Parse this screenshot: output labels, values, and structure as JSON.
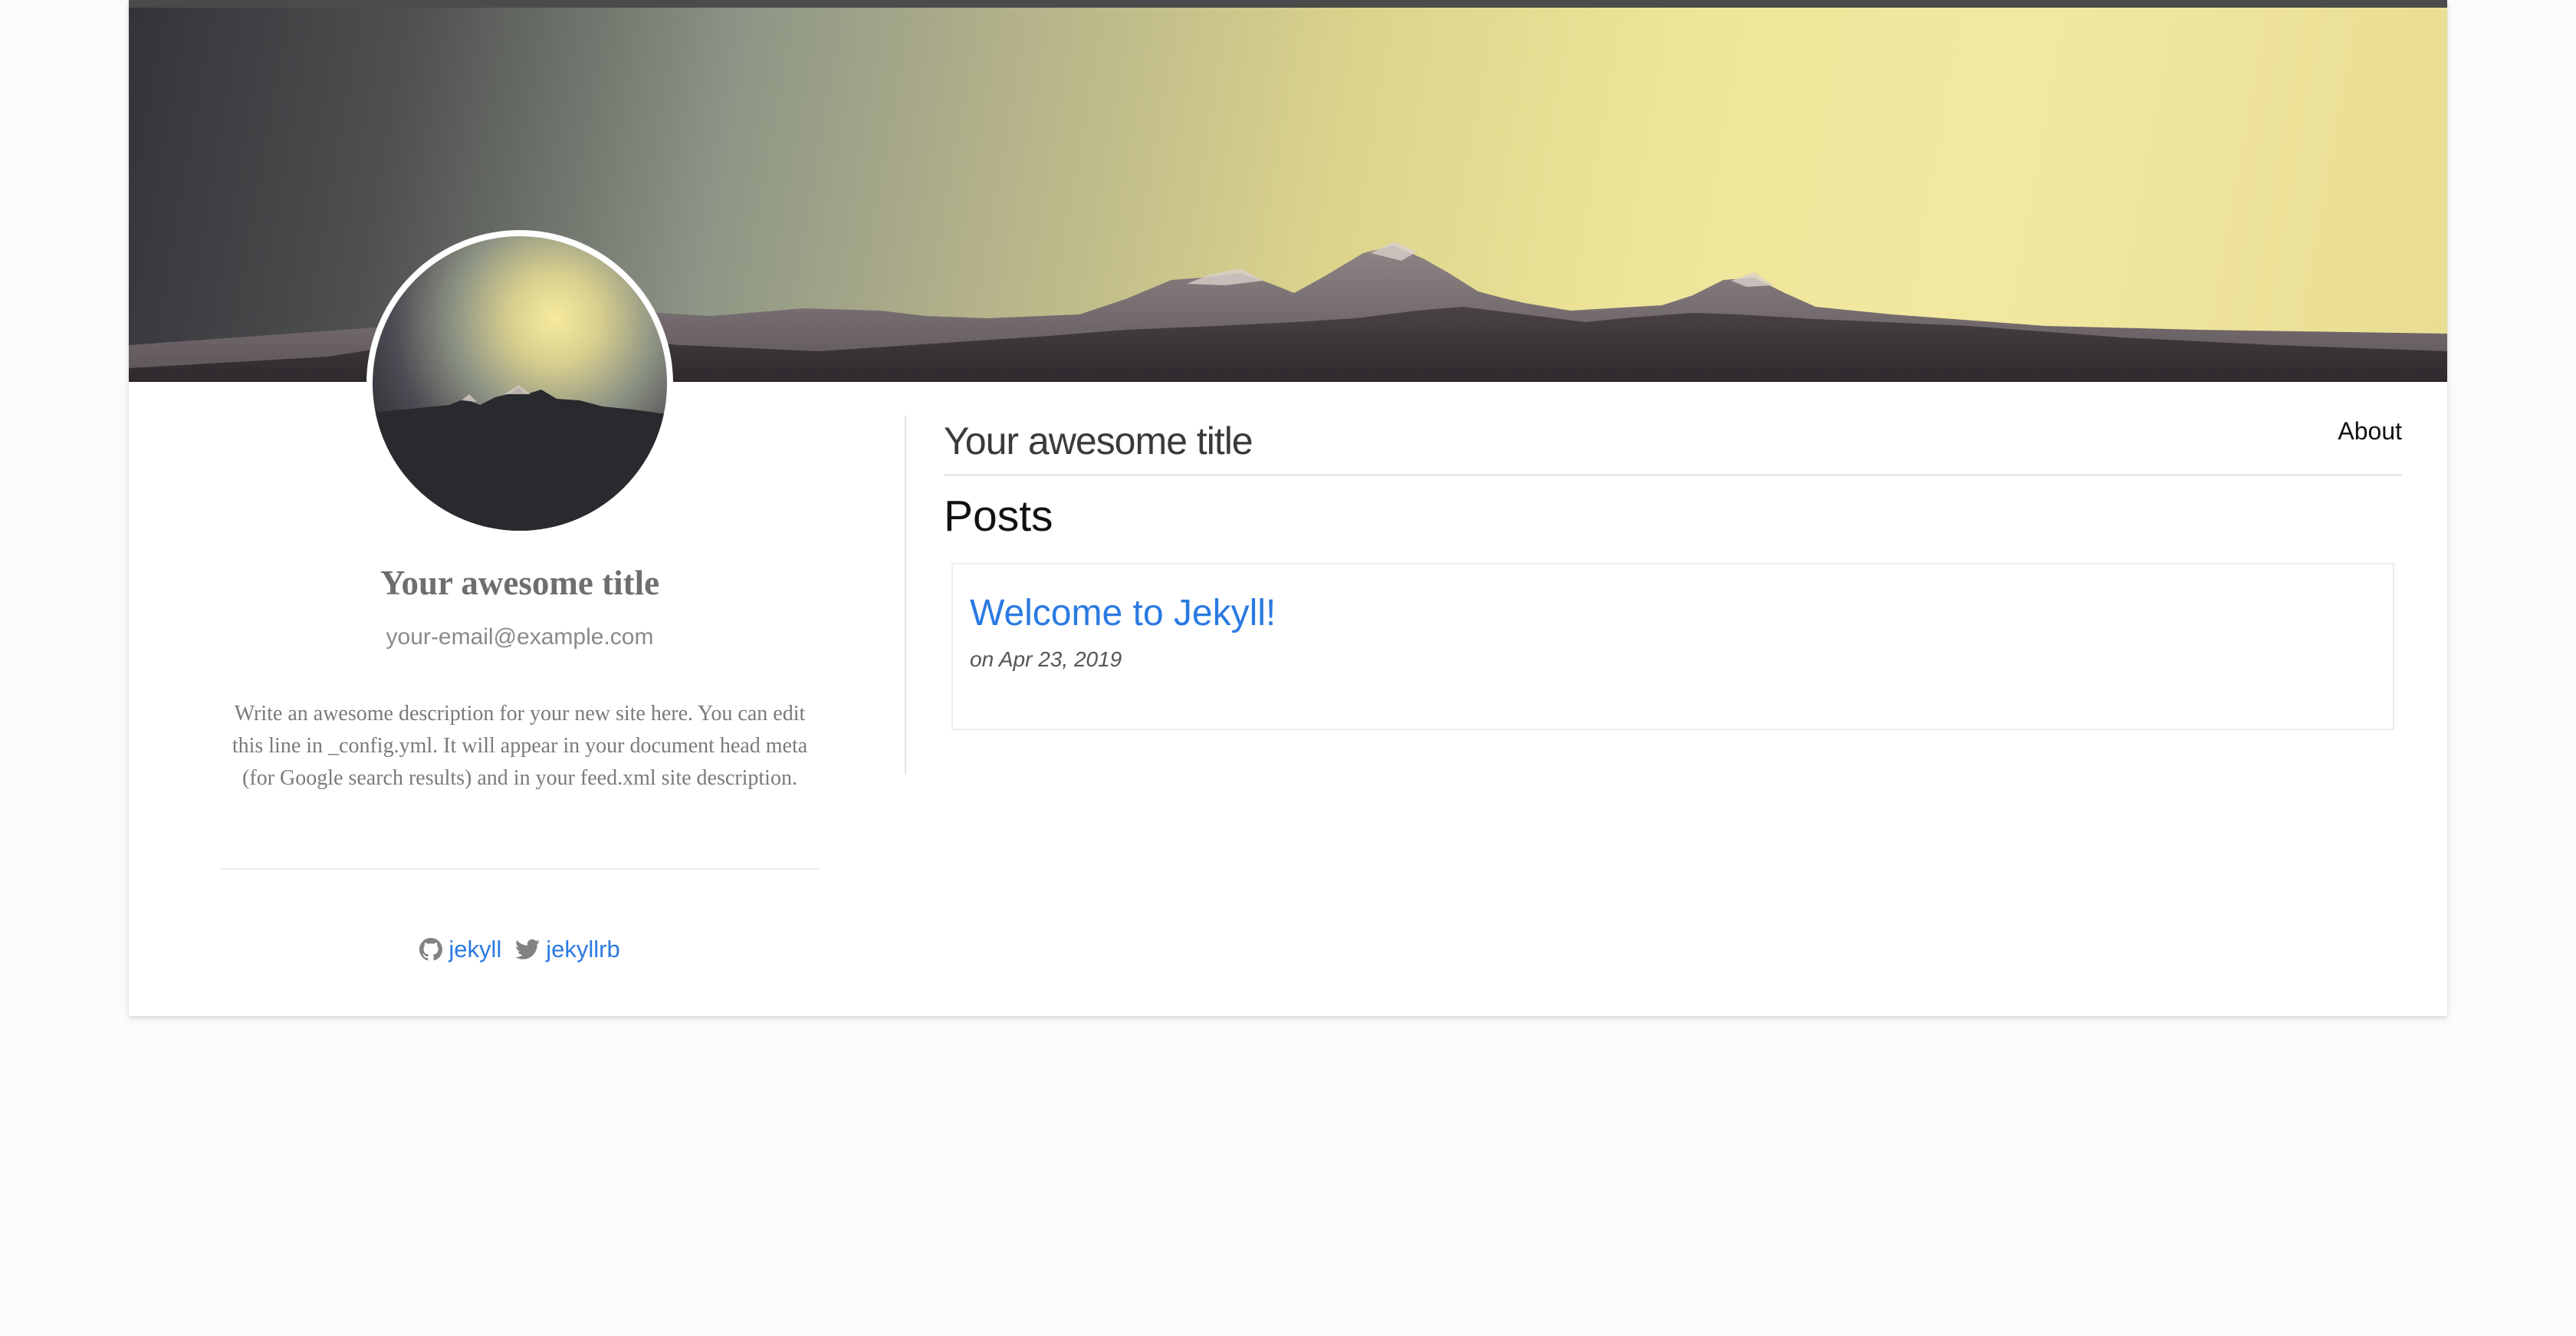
{
  "profile": {
    "name": "Your awesome title",
    "email": "your-email@example.com",
    "description": "Write an awesome description for your new site here. You can edit this line in _config.yml. It will appear in your document head meta (for Google search results) and in your feed.xml site description."
  },
  "social": [
    {
      "icon": "github-icon",
      "label": "jekyll"
    },
    {
      "icon": "twitter-icon",
      "label": "jekyllrb"
    }
  ],
  "header": {
    "site_title": "Your awesome title",
    "nav_about": "About"
  },
  "posts": {
    "heading": "Posts",
    "items": [
      {
        "title": "Welcome to Jekyll!",
        "date": "on Apr 23, 2019"
      }
    ]
  },
  "colors": {
    "link": "#2a7ae2",
    "page_background": "#fbfbfb",
    "card_background": "#ffffff"
  }
}
